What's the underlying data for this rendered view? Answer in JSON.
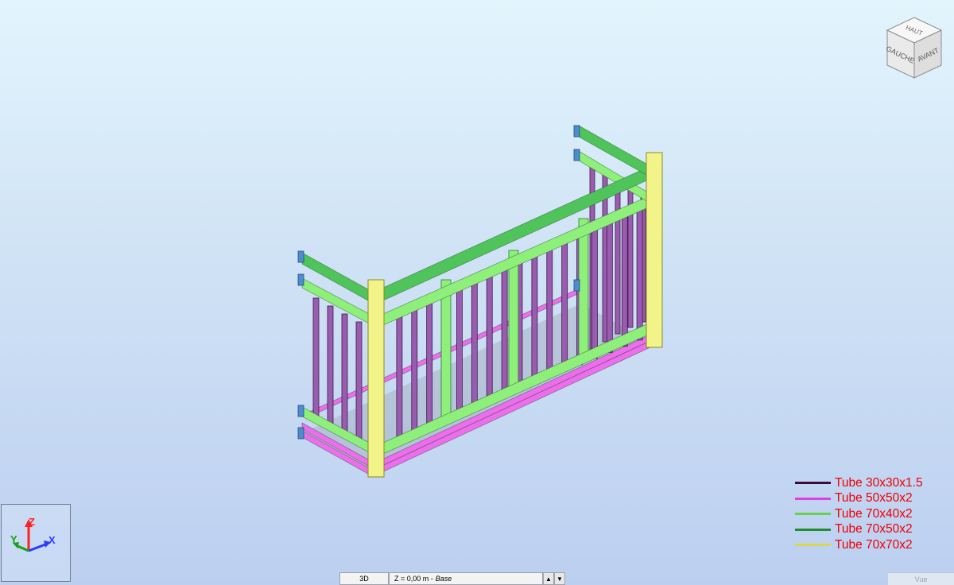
{
  "viewcube": {
    "faces": {
      "top": "HAUT",
      "left": "GAUCHE",
      "front": "AVANT"
    }
  },
  "legend": [
    {
      "label": "Tube 30x30x1.5",
      "color": "#3a0e3a"
    },
    {
      "label": "Tube 50x50x2",
      "color": "#e040e0"
    },
    {
      "label": "Tube 70x40x2",
      "color": "#66d44a"
    },
    {
      "label": "Tube 70x50x2",
      "color": "#1f8f2e"
    },
    {
      "label": "Tube 70x70x2",
      "color": "#d8d84a"
    }
  ],
  "triad": {
    "x": "X",
    "y": "Y",
    "z": "Z"
  },
  "viewbar": {
    "mode": "3D",
    "level": "Z = 0,00 m -",
    "level_name": "Base",
    "prev": "▲",
    "next": "▼"
  },
  "vue_tab": "Vue",
  "colors": {
    "purple_bar": "#9a5cb0",
    "pink_frame": "#ee6cee",
    "light_green": "#8ef07a",
    "dark_green": "#4fc45a",
    "yellow_post": "#f2f48a",
    "blue_plate": "#4d8ccf"
  }
}
